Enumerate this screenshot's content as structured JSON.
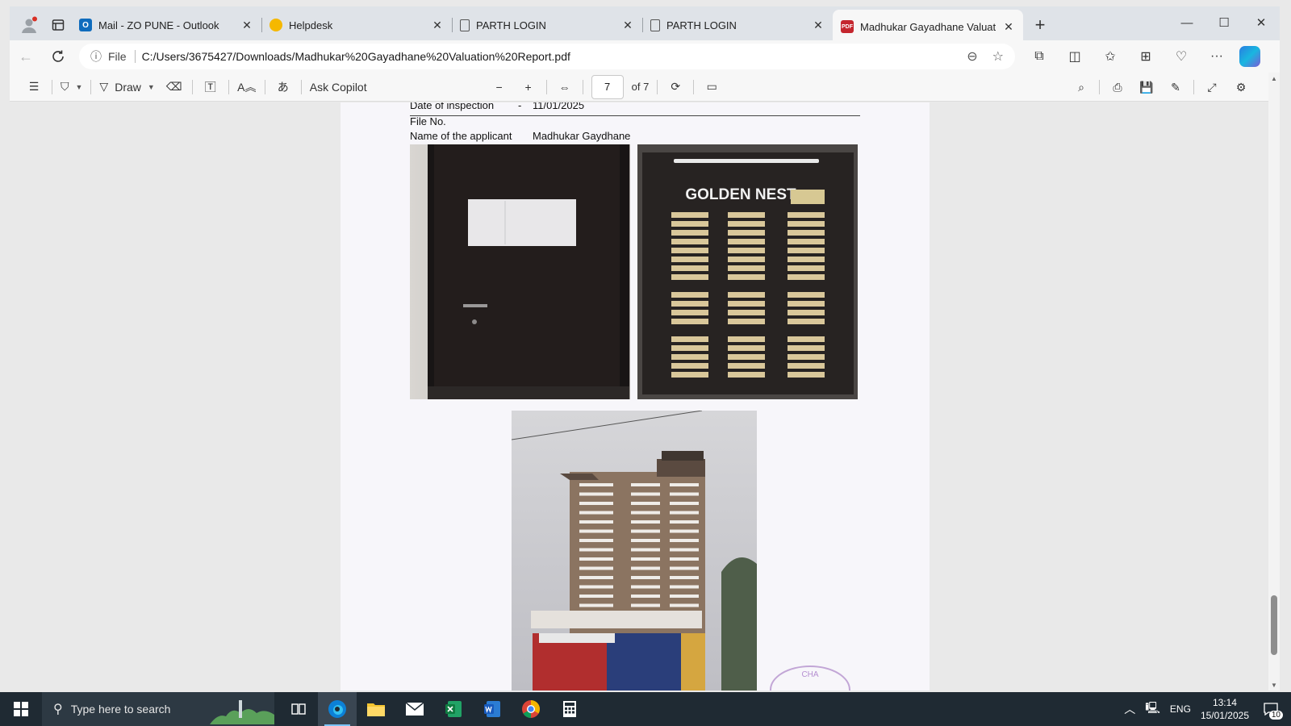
{
  "tabs": [
    {
      "label": "Mail - ZO PUNE - Outlook",
      "favicon": "outlook-icon"
    },
    {
      "label": "Helpdesk",
      "favicon": "helpdesk-icon"
    },
    {
      "label": "PARTH LOGIN",
      "favicon": "document-icon"
    },
    {
      "label": "PARTH LOGIN",
      "favicon": "document-icon"
    },
    {
      "label": "Madhukar Gayadhane Valuation F",
      "favicon": "pdf-icon",
      "active": true
    }
  ],
  "address": {
    "scheme_label": "File",
    "url": "C:/Users/3675427/Downloads/Madhukar%20Gayadhane%20Valuation%20Report.pdf"
  },
  "pdf_toolbar": {
    "draw_label": "Draw",
    "copilot_label": "Ask Copilot",
    "page_current": "7",
    "page_total": "of 7"
  },
  "document": {
    "inspection_label": "Date of inspection",
    "inspection_sep": "-",
    "inspection_date": "11/01/2025",
    "file_label": "File No.",
    "applicant_label": "Name of the applicant",
    "applicant_name": "Madhukar Gaydhane",
    "sign_text": "GOLDEN NEST",
    "stamp_text": "CHA"
  },
  "taskbar": {
    "search_placeholder": "Type here to search",
    "language": "ENG",
    "time": "13:14",
    "date": "15/01/2025",
    "notifications": "10"
  },
  "colors": {
    "accent": "#0f6cbd",
    "taskbar": "#1f2a33",
    "pdf_red": "#c4262e"
  }
}
